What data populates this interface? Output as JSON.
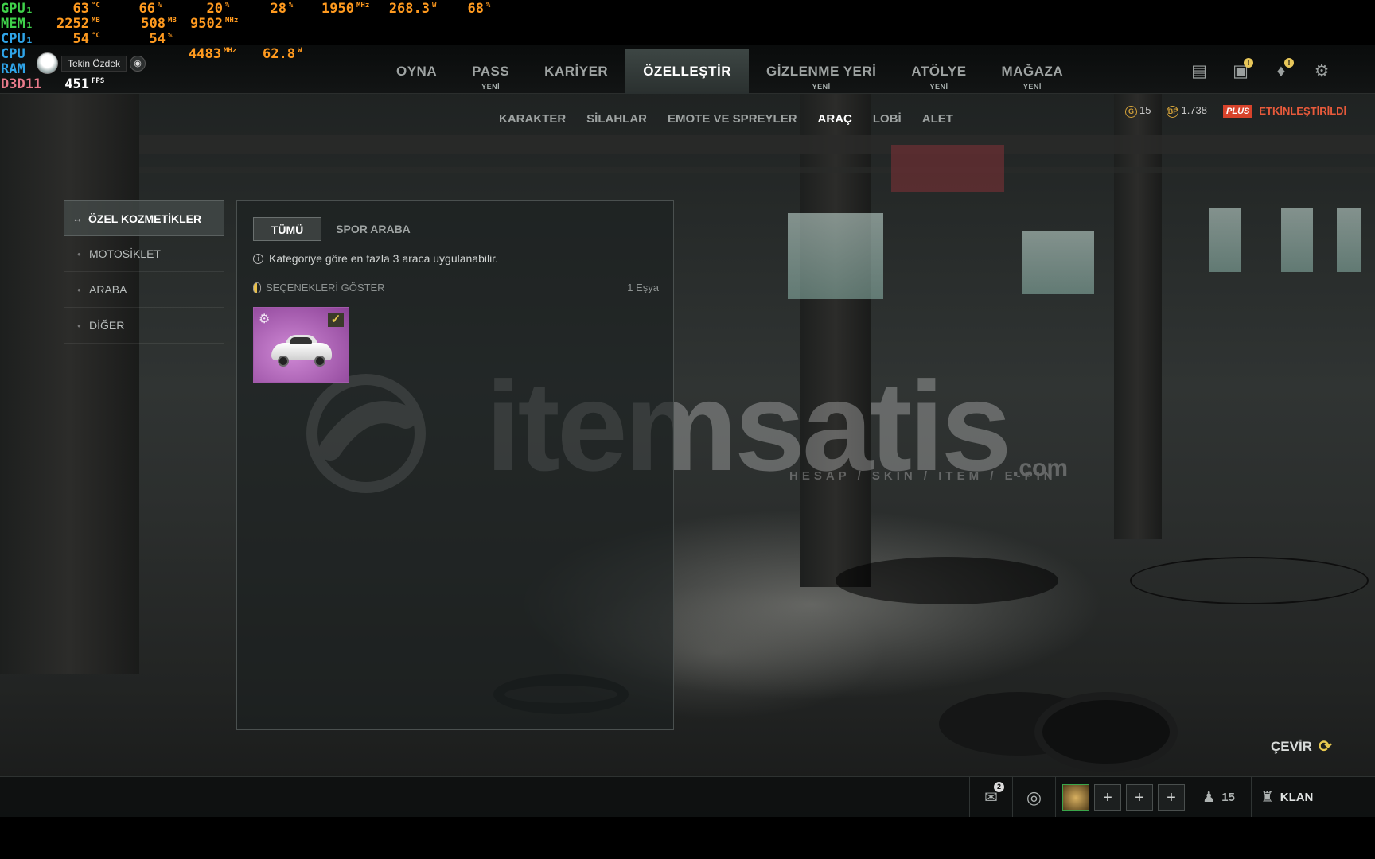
{
  "hud": {
    "rows": [
      {
        "label": "GPU₁",
        "color": "#3fd14a",
        "values": [
          {
            "v": "63",
            "u": "°C"
          },
          {
            "v": "66",
            "u": "%"
          },
          {
            "v": "20",
            "u": "%"
          },
          {
            "v": "28",
            "u": "%"
          },
          {
            "v": "1950",
            "u": "MHz"
          },
          {
            "v": "268.3",
            "u": "W"
          },
          {
            "v": "68",
            "u": "%"
          }
        ]
      },
      {
        "label": "MEM₁",
        "color": "#3fd14a",
        "values": [
          {
            "v": "2252",
            "u": "MB"
          },
          {
            "v": "508",
            "u": "MB"
          },
          {
            "v": "9502",
            "u": "MHz"
          }
        ]
      },
      {
        "label": "CPU₁",
        "color": "#2fa4e8",
        "values": [
          {
            "v": "54",
            "u": "°C"
          },
          {
            "v": "54",
            "u": "%"
          }
        ]
      },
      {
        "label": "CPU",
        "color": "#2fa4e8",
        "values": [
          {
            "v": "4483",
            "u": "MHz"
          },
          {
            "v": "62.8",
            "u": "W"
          }
        ]
      },
      {
        "label": "RAM",
        "color": "#2fa4e8",
        "values": []
      },
      {
        "label": "D3D11",
        "color": "#e87a8a",
        "values": [
          {
            "v": "451",
            "u": "FPS"
          }
        ]
      }
    ]
  },
  "user": {
    "name": "Tekin Özdek"
  },
  "nav": {
    "items": [
      {
        "label": "OYNA",
        "badge": ""
      },
      {
        "label": "PASS",
        "badge": "YENİ"
      },
      {
        "label": "KARİYER",
        "badge": ""
      },
      {
        "label": "ÖZELLEŞTİR",
        "badge": "",
        "active": true
      },
      {
        "label": "GİZLENME YERİ",
        "badge": "YENİ"
      },
      {
        "label": "ATÖLYE",
        "badge": "YENİ"
      },
      {
        "label": "MAĞAZA",
        "badge": "YENİ"
      }
    ],
    "icons": [
      "inventory-icon",
      "news-icon",
      "bell-icon",
      "gear-icon"
    ]
  },
  "subnav": {
    "items": [
      "KARAKTER",
      "SİLAHLAR",
      "EMOTE VE SPREYLER",
      "ARAÇ",
      "LOBİ",
      "ALET"
    ],
    "active_index": 3
  },
  "currency": {
    "g_coin": "15",
    "bp": "1.738",
    "plus_badge": "PLUS",
    "status": "ETKİNLEŞTİRİLDİ"
  },
  "sidebar": {
    "items": [
      {
        "label": "ÖZEL KOZMETİKLER",
        "active": true
      },
      {
        "label": "MOTOSİKLET"
      },
      {
        "label": "ARABA"
      },
      {
        "label": "DİĞER"
      }
    ]
  },
  "panel": {
    "tabs": [
      "TÜMÜ",
      "SPOR ARABA"
    ],
    "info": "Kategoriye göre en fazla 3 araca uygulanabilir.",
    "options_label": "SEÇENEKLERİ GÖSTER",
    "count": "1 Eşya"
  },
  "watermark": {
    "brand": "itemsatis",
    "tagline": "HESAP / SKIN / ITEM / E-PIN",
    "suffix": ".com"
  },
  "rotate_label": "ÇEVİR",
  "bottombar": {
    "chat_badge": "2",
    "party_count": "15",
    "clan_label": "KLAN"
  },
  "colors": {
    "accent": "#e7c850",
    "plus": "#d8432b",
    "hud_value": "#ff9a1f"
  }
}
